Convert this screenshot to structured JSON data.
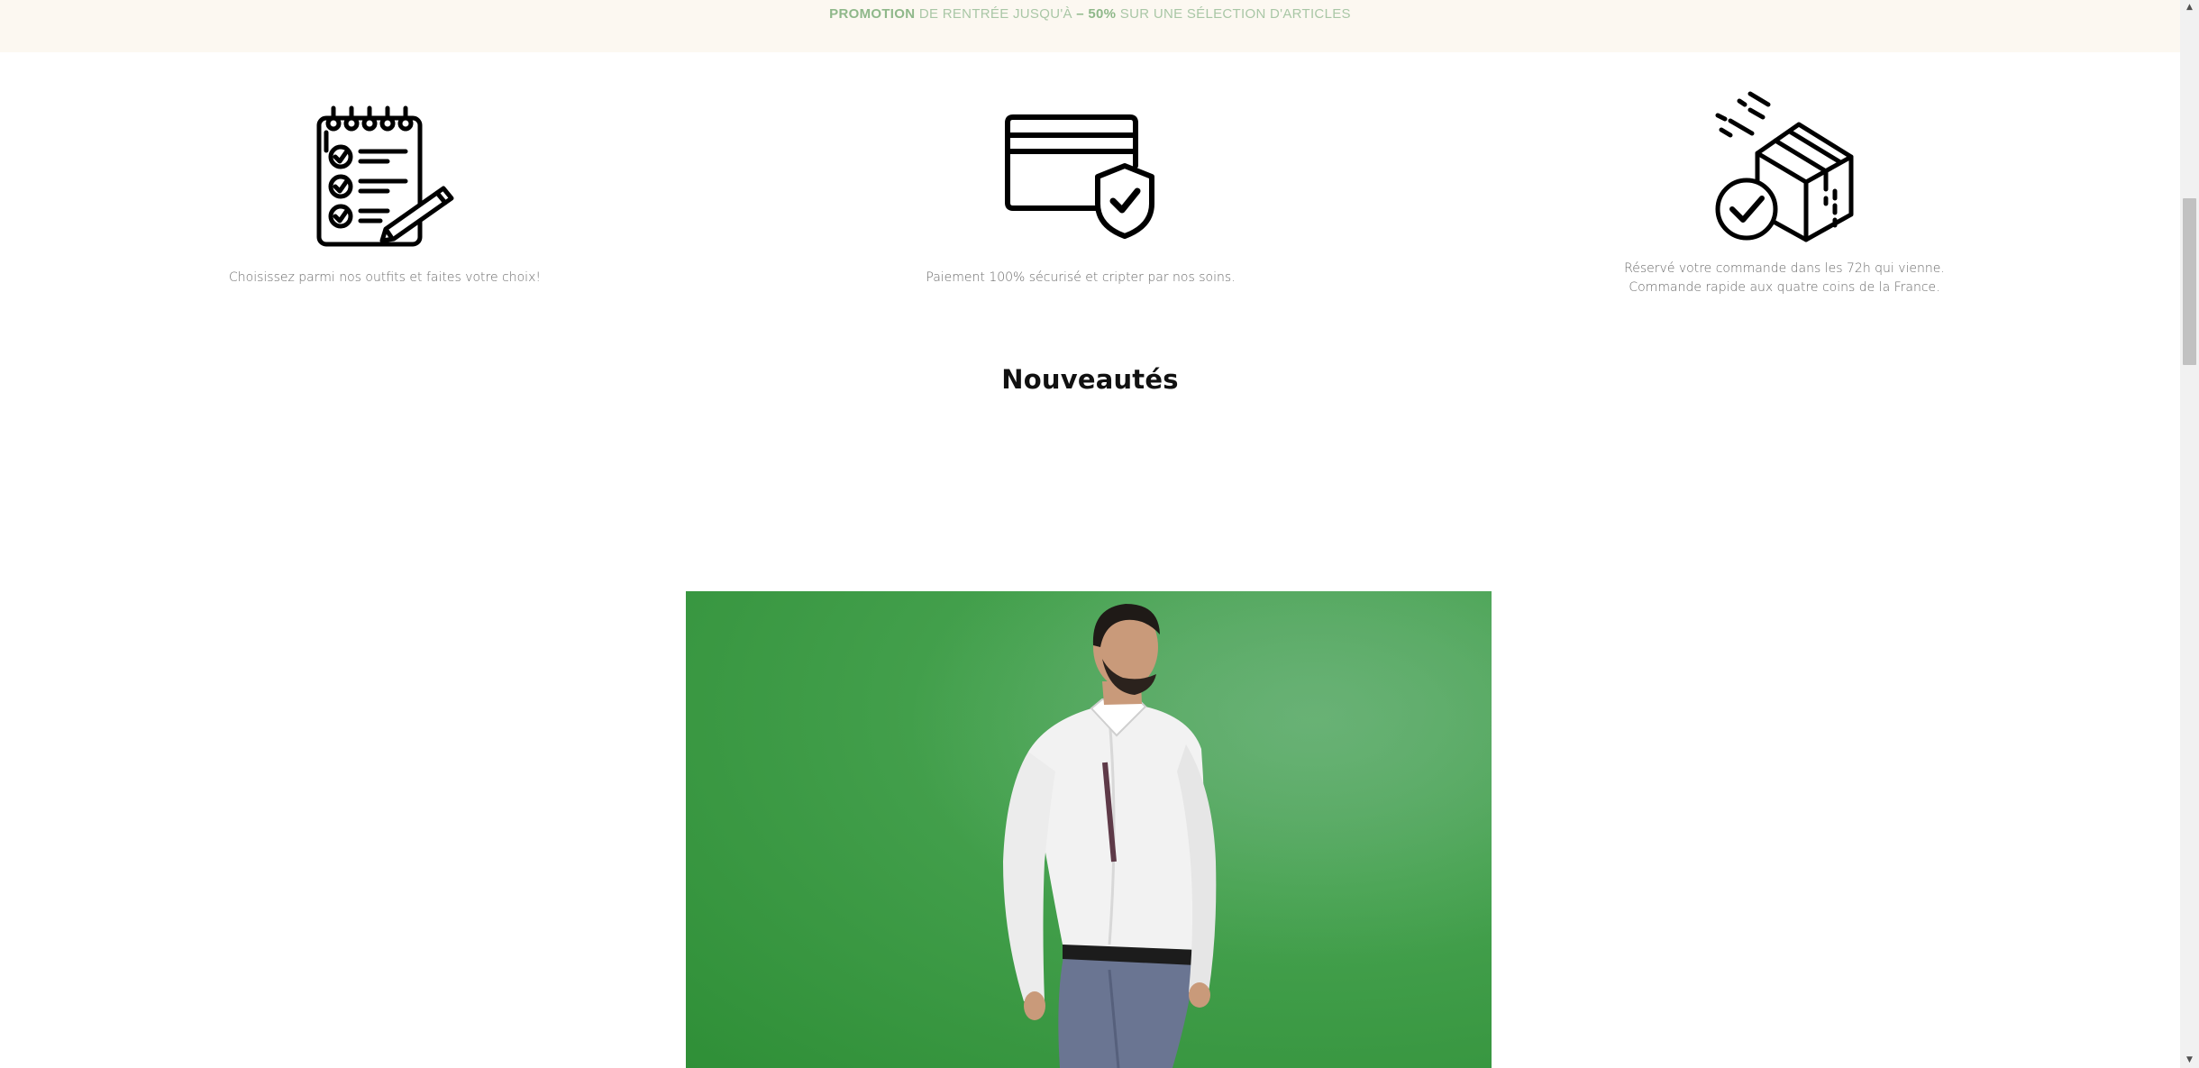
{
  "promo": {
    "strong1": "PROMOTION",
    "text1": " DE RENTRÉE JUSQU'À ",
    "strong2": "– 50%",
    "text2": " SUR UNE SÉLECTION D'ARTICLES"
  },
  "features": [
    {
      "icon": "checklist-icon",
      "caption": "Choisissez parmi nos outfits et faites votre choix!"
    },
    {
      "icon": "secure-card-icon",
      "caption": "Paiement 100% sécurisé et cripter par nos soins."
    },
    {
      "icon": "delivery-box-icon",
      "caption_line1": "Réservé votre commande dans les 72h qui vienne.",
      "caption_line2": "Commande rapide aux quatre coins de la France."
    }
  ],
  "section": {
    "title": "Nouveautés"
  },
  "colors": {
    "promo_bg": "#fcf8f1",
    "promo_text": "#a9c7a6",
    "product_bg": "#46a24f"
  },
  "scrollbar": {
    "up": "▲",
    "down": "▼"
  }
}
